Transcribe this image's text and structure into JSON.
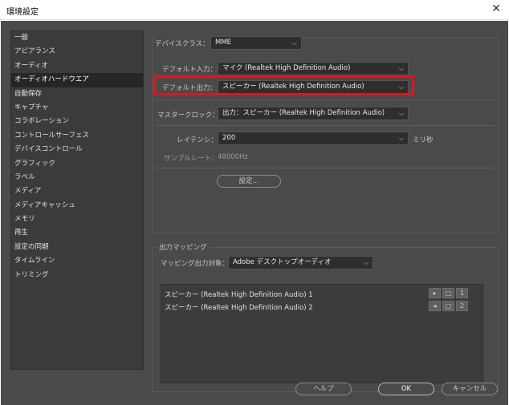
{
  "window": {
    "title": "環境設定",
    "close_glyph": "✕"
  },
  "sidebar": {
    "items": [
      {
        "label": "一般"
      },
      {
        "label": "アピアランス"
      },
      {
        "label": "オーディオ"
      },
      {
        "label": "オーディオハードウエア",
        "selected": true
      },
      {
        "label": "自動保存"
      },
      {
        "label": "キャプチャ"
      },
      {
        "label": "コラボレーション"
      },
      {
        "label": "コントロールサーフェス"
      },
      {
        "label": "デバイスコントロール"
      },
      {
        "label": "グラフィック"
      },
      {
        "label": "ラベル"
      },
      {
        "label": "メディア"
      },
      {
        "label": "メディアキャッシュ"
      },
      {
        "label": "メモリ"
      },
      {
        "label": "再生"
      },
      {
        "label": "設定の同期"
      },
      {
        "label": "タイムライン"
      },
      {
        "label": "トリミング"
      }
    ]
  },
  "device": {
    "class_label": "デバイスクラス：",
    "class_value": "MME",
    "default_input_label": "デフォルト入力：",
    "default_input_value": "マイク (Realtek High Definition Audio)",
    "default_output_label": "デフォルト出力：",
    "default_output_value": "スピーカー (Realtek High Definition Audio)",
    "master_clock_label": "マスタークロック：",
    "master_clock_value": "出力：スピーカー (Realtek High Definition Audio)",
    "latency_label": "レイテンシ：",
    "latency_value": "200",
    "latency_unit": "ミリ秒",
    "sample_rate_label": "サンプルレート：",
    "sample_rate_value": "48000Hz",
    "settings_button": "設定..."
  },
  "output_mapping": {
    "title": "出力マッピング",
    "target_label": "マッピング出力対象：",
    "target_value": "Adobe デスクトップオーディオ",
    "rows": [
      {
        "label": "スピーカー (Realtek High Definition Audio) 1",
        "channel": "1"
      },
      {
        "label": "スピーカー (Realtek High Definition Audio) 2",
        "channel": "2"
      }
    ]
  },
  "footer": {
    "help": "ヘルプ",
    "ok": "OK",
    "cancel": "キャンセル"
  },
  "colors": {
    "panel": "#4a4a4a",
    "list": "#3b3b3b",
    "highlight": "#e0141e"
  },
  "icons": {
    "dropdown": "chevron-down-icon",
    "close": "close-icon",
    "speaker": "speaker-icon",
    "frame": "frame-icon"
  }
}
